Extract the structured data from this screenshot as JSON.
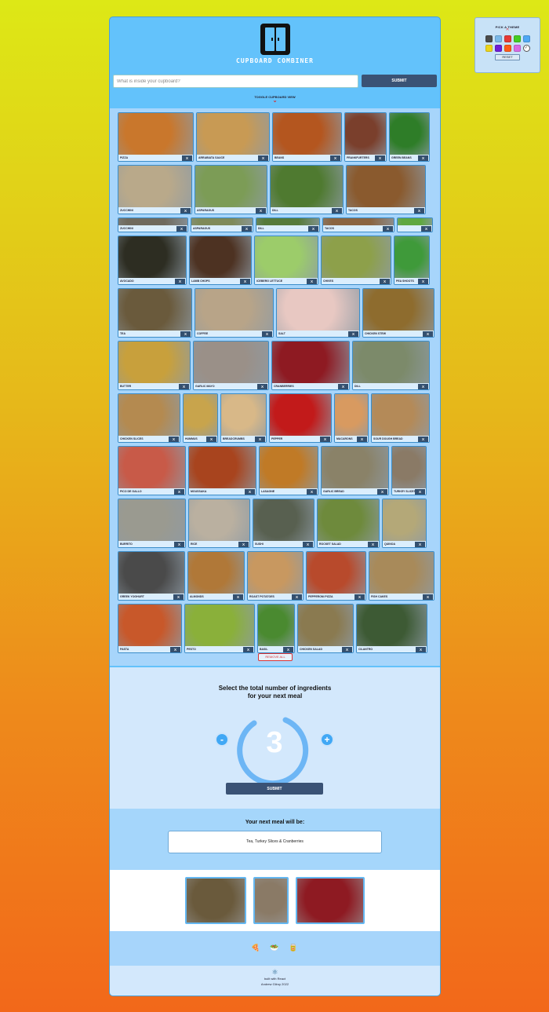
{
  "theme_picker": {
    "title": "PICK A THEME",
    "swatches": [
      "#4b4b4b",
      "#7ab8e8",
      "#e53935",
      "#44cc22",
      "#4fa8f4",
      "#ecd41a",
      "#6f1cd4",
      "#ff5a18",
      "#d86ae4",
      "selected"
    ],
    "selected_mark": "✓",
    "reset_label": "RESET"
  },
  "app": {
    "logo_text": "CUPBOARD COMBINER",
    "search": {
      "placeholder": "What is inside your cupboard?",
      "submit_label": "SUBMIT"
    },
    "toggle_label": "TOGGLE CUPBOARD VIEW",
    "remove_all_label": "REMOVE ALL",
    "x_label": "X"
  },
  "ingredients": [
    {
      "name": "Pizza",
      "color": "#c9772c"
    },
    {
      "name": "Arrabiata Sauce",
      "color": "#c89a54"
    },
    {
      "name": "Beans",
      "color": "#b4561f"
    },
    {
      "name": "Frankfurters",
      "color": "#7a3f2c"
    },
    {
      "name": "Green Beans",
      "color": "#2e7d28"
    },
    {
      "name": "Zucchini",
      "color": "#b9a98a"
    },
    {
      "name": "Asparagus",
      "color": "#7c9c56"
    },
    {
      "name": "Dill",
      "color": "#4f7a30"
    },
    {
      "name": "Tacos",
      "color": "#8a5a2e"
    },
    {
      "name": "Zucchini",
      "color": "#6f6a5e"
    },
    {
      "name": "Asparagus",
      "color": "#7f8a5a"
    },
    {
      "name": "Dill",
      "color": "#567a3a"
    },
    {
      "name": "Tacos",
      "color": "#8a6440"
    },
    {
      "name": "",
      "color": "#60a840"
    },
    {
      "name": "Avocado",
      "color": "#2d2d22"
    },
    {
      "name": "Lamb Chops",
      "color": "#4d3222"
    },
    {
      "name": "Iceberg Lettuce",
      "color": "#9ccc6a"
    },
    {
      "name": "Chives",
      "color": "#8da04a"
    },
    {
      "name": "Pea Shoots",
      "color": "#3f9a3a"
    },
    {
      "name": "Tea",
      "color": "#6a5a3c"
    },
    {
      "name": "Coffee",
      "color": "#b8a488"
    },
    {
      "name": "Salt",
      "color": "#e8c8c2"
    },
    {
      "name": "Chicken Stew",
      "color": "#8e6c2e"
    },
    {
      "name": "Butter",
      "color": "#c8a03c"
    },
    {
      "name": "Garlic Mayo",
      "color": "#9a9088"
    },
    {
      "name": "Cranberries",
      "color": "#8e1a22"
    },
    {
      "name": "Dill",
      "color": "#7c8a6a"
    },
    {
      "name": "Chicken Slices",
      "color": "#b48a50"
    },
    {
      "name": "Hummus",
      "color": "#c8a44c"
    },
    {
      "name": "Breadcrumbs",
      "color": "#d8b888"
    },
    {
      "name": "Pepper",
      "color": "#c21a1a"
    },
    {
      "name": "Macarons",
      "color": "#d89a60"
    },
    {
      "name": "Sour Dough Bread",
      "color": "#b48a58"
    },
    {
      "name": "Pico De Gallo",
      "color": "#c85a48"
    },
    {
      "name": "Moussaka",
      "color": "#a8441e"
    },
    {
      "name": "Lasagne",
      "color": "#c07a26"
    },
    {
      "name": "Garlic Bread",
      "color": "#8a8268"
    },
    {
      "name": "Turkey Slices",
      "color": "#8a7a66"
    },
    {
      "name": "Burrito",
      "color": "#9a9a90"
    },
    {
      "name": "Rice",
      "color": "#bab0a0"
    },
    {
      "name": "Sushi",
      "color": "#586050"
    },
    {
      "name": "Rocket Salad",
      "color": "#6e8a3c"
    },
    {
      "name": "Quinoa",
      "color": "#b4a878"
    },
    {
      "name": "Greek Yoghurt",
      "color": "#4a4a4a"
    },
    {
      "name": "Almonds",
      "color": "#b07838"
    },
    {
      "name": "Roast Potatoes",
      "color": "#c89860"
    },
    {
      "name": "Pepperoni Pizza",
      "color": "#b84a2c"
    },
    {
      "name": "Fish Cakes",
      "color": "#a88a5a"
    },
    {
      "name": "Pasta",
      "color": "#c8582a"
    },
    {
      "name": "Pesto",
      "color": "#8ab03a"
    },
    {
      "name": "Basil",
      "color": "#4a8a30"
    },
    {
      "name": "Chicken Salad",
      "color": "#8a7a50"
    },
    {
      "name": "Cilantro",
      "color": "#3d5a34"
    }
  ],
  "select": {
    "title_line1": "Select the total number of ingredients",
    "title_line2": "for your next meal",
    "count": "3",
    "count_value": 3,
    "minus_label": "-",
    "plus_label": "+",
    "submit_label": "SUBMIT"
  },
  "result": {
    "title": "Your next meal will be:",
    "meal": "Tea, Turkey Slices & Cranberries",
    "selected_colors": [
      "#6a5a3c",
      "#8a7a66",
      "#8e1a22"
    ]
  },
  "footer": {
    "icons": [
      "🍕",
      "🥗",
      "🥫"
    ],
    "react_icon": "⚛",
    "built_with": "built with React",
    "credit": "Andrew Gilroy 2022"
  }
}
